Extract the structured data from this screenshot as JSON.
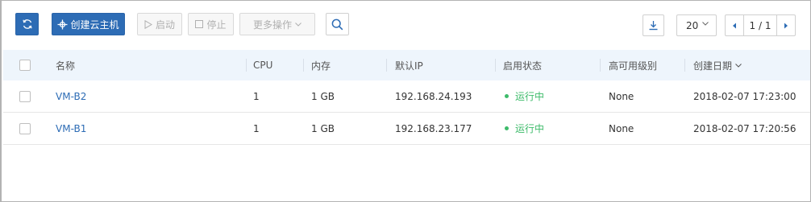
{
  "toolbar": {
    "create_label": "创建云主机",
    "start_label": "启动",
    "stop_label": "停止",
    "more_label": "更多操作",
    "page_size": "20",
    "page_info": "1 / 1"
  },
  "table": {
    "headers": {
      "name": "名称",
      "cpu": "CPU",
      "memory": "内存",
      "ip": "默认IP",
      "state": "启用状态",
      "ha": "高可用级别",
      "created": "创建日期"
    },
    "rows": [
      {
        "name": "VM-B2",
        "cpu": "1",
        "memory": "1 GB",
        "ip": "192.168.24.193",
        "state": "运行中",
        "ha": "None",
        "created": "2018-02-07 17:23:00"
      },
      {
        "name": "VM-B1",
        "cpu": "1",
        "memory": "1 GB",
        "ip": "192.168.23.177",
        "state": "运行中",
        "ha": "None",
        "created": "2018-02-07 17:20:56"
      }
    ]
  },
  "colors": {
    "primary": "#2d6cb5",
    "running": "#3dbb6a",
    "header_bg": "#eef5fc"
  },
  "icons": [
    "refresh-icon",
    "plus-icon",
    "play-icon",
    "stop-icon",
    "chevron-down-icon",
    "search-icon",
    "download-icon",
    "chevron-left-icon",
    "chevron-right-icon"
  ]
}
